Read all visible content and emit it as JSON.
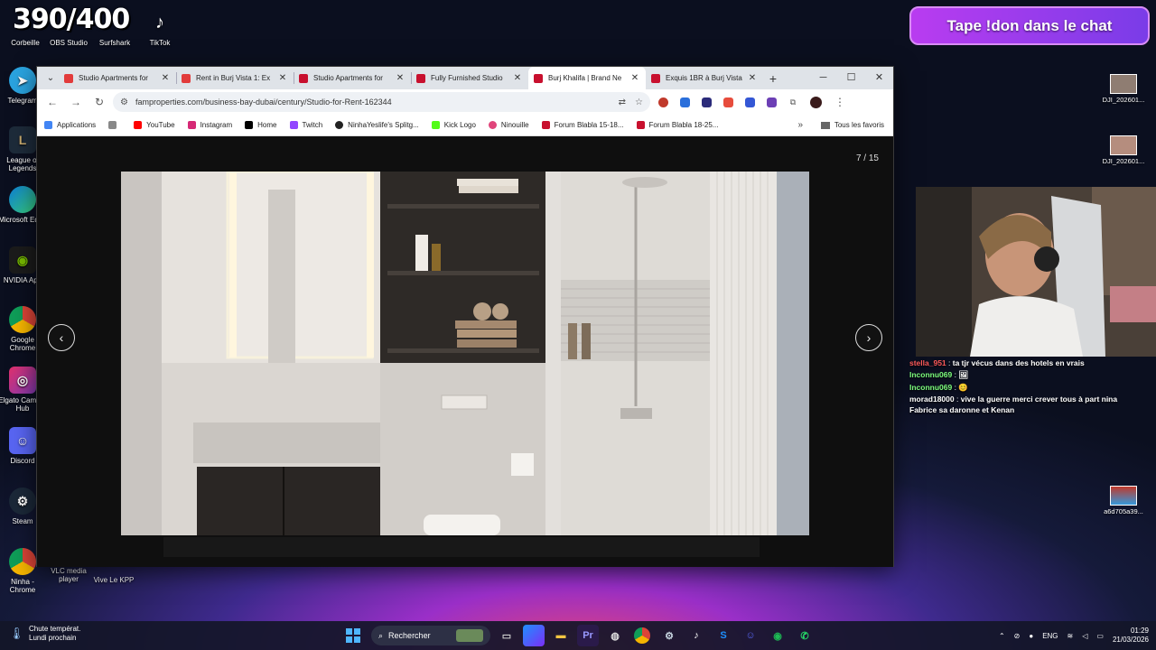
{
  "overlay_counter": "390/400",
  "desktop": {
    "top_icons": [
      "Corbeille",
      "OBS Studio",
      "Surfshark",
      "TikTok"
    ],
    "left_icons": [
      "Telegram",
      "League of Legends",
      "Microsoft Edge",
      "NVIDIA App",
      "Google Chrome",
      "Elgato Camera Hub",
      "Discord",
      "Steam",
      "Ninha - Chrome"
    ],
    "bottom_icons": [
      "VLC media player",
      "Vive Le KPP"
    ],
    "right_files": [
      "DJI_202601...",
      "DJI_202601...",
      "a6d705a39..."
    ]
  },
  "browser": {
    "tabs": [
      {
        "title": "Studio Apartments for",
        "color": "#e23b3b"
      },
      {
        "title": "Rent in Burj Vista 1: Ex",
        "color": "#e23b3b"
      },
      {
        "title": "Studio Apartments for",
        "color": "#c8102e"
      },
      {
        "title": "Fully Furnished Studio",
        "color": "#c8102e"
      },
      {
        "title": "Burj Khalifa | Brand Ne",
        "color": "#c8102e",
        "active": true
      },
      {
        "title": "Exquis 1BR à Burj Vista",
        "color": "#c8102e"
      }
    ],
    "url": "famproperties.com/business-bay-dubai/century/Studio-for-Rent-162344",
    "bookmarks": [
      {
        "label": "Applications",
        "color": "#4285f4"
      },
      {
        "label": "YouTube",
        "color": "#ff0000"
      },
      {
        "label": "Instagram",
        "color": "#d62976"
      },
      {
        "label": "Home",
        "color": "#000000"
      },
      {
        "label": "Twitch",
        "color": "#9146ff"
      },
      {
        "label": "NinhaYeslife's Splitg...",
        "color": "#222222"
      },
      {
        "label": "Kick Logo",
        "color": "#53fc18"
      },
      {
        "label": "Ninouille",
        "color": "#e0457b"
      },
      {
        "label": "Forum Blabla 15-18...",
        "color": "#c8102e"
      },
      {
        "label": "Forum Blabla 18-25...",
        "color": "#c8102e"
      }
    ],
    "all_bookmarks": "Tous les favoris",
    "gallery_counter": "7 / 15"
  },
  "stream": {
    "donate_banner": "Tape !don dans le chat",
    "chat": [
      {
        "user": "stella_951",
        "user_color": "#ff5a5a",
        "msg": "ta tjr vécus dans des hotels en vrais"
      },
      {
        "user": "Inconnu069",
        "user_color": "#7dff7d",
        "msg": "🖼"
      },
      {
        "user": "Inconnu069",
        "user_color": "#7dff7d",
        "msg": "😊"
      },
      {
        "user": "morad18000",
        "user_color": "#ffffff",
        "msg": "vive la guerre merci crever tous à part nina Fabrice sa daronne et Kenan"
      }
    ]
  },
  "taskbar": {
    "weather_line1": "Chute températ.",
    "weather_line2": "Lundi prochain",
    "search": "Rechercher",
    "lang": "ENG",
    "time": "01:29",
    "date": "21/03/2026"
  }
}
